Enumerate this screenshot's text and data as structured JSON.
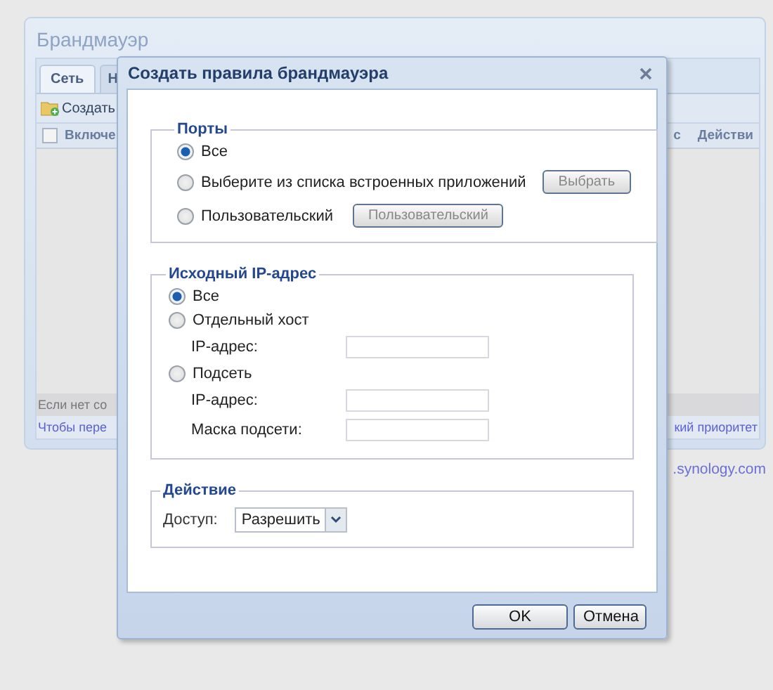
{
  "app": {
    "title": "Брандмауэр",
    "tabs": [
      {
        "label": "Сеть",
        "selected": true
      },
      {
        "label": "Н",
        "selected": false
      }
    ],
    "toolbar": {
      "create_button": "Создать"
    },
    "grid": {
      "header_checkbox": {
        "checked": false
      },
      "columns": [
        "Включе",
        "с",
        "Действи"
      ]
    },
    "footer_lines": [
      {
        "left": "Если нет со"
      },
      {
        "left": "Чтобы пере",
        "right": "кий приоритет"
      }
    ]
  },
  "link": ".synology.com",
  "dialog": {
    "title": "Создать правила брандмауэра",
    "ports": {
      "legend": "Порты",
      "options": [
        {
          "kind": "plain",
          "label": "Все",
          "selected": true
        },
        {
          "kind": "button",
          "label": "Выберите из списка встроенных приложений",
          "selected": false,
          "button": {
            "label": "Выбрать",
            "disabled": true
          }
        },
        {
          "kind": "button",
          "label": "Пользовательский",
          "selected": false,
          "button": {
            "label": "Пользовательский",
            "disabled": true
          }
        }
      ]
    },
    "source_ip": {
      "legend": "Исходный IP-адрес",
      "options": [
        {
          "label": "Все",
          "selected": true
        },
        {
          "label": "Отдельный хост",
          "selected": false,
          "fields": [
            {
              "label": "IP-адрес:"
            }
          ]
        },
        {
          "label": "Подсеть",
          "selected": false,
          "fields": [
            {
              "label": "IP-адрес:"
            },
            {
              "label": "Маска подсети:"
            }
          ]
        }
      ]
    },
    "action": {
      "legend": "Действие",
      "label": "Доступ:",
      "value": "Разрешить"
    },
    "buttons": [
      "OK",
      "Отмена"
    ]
  }
}
